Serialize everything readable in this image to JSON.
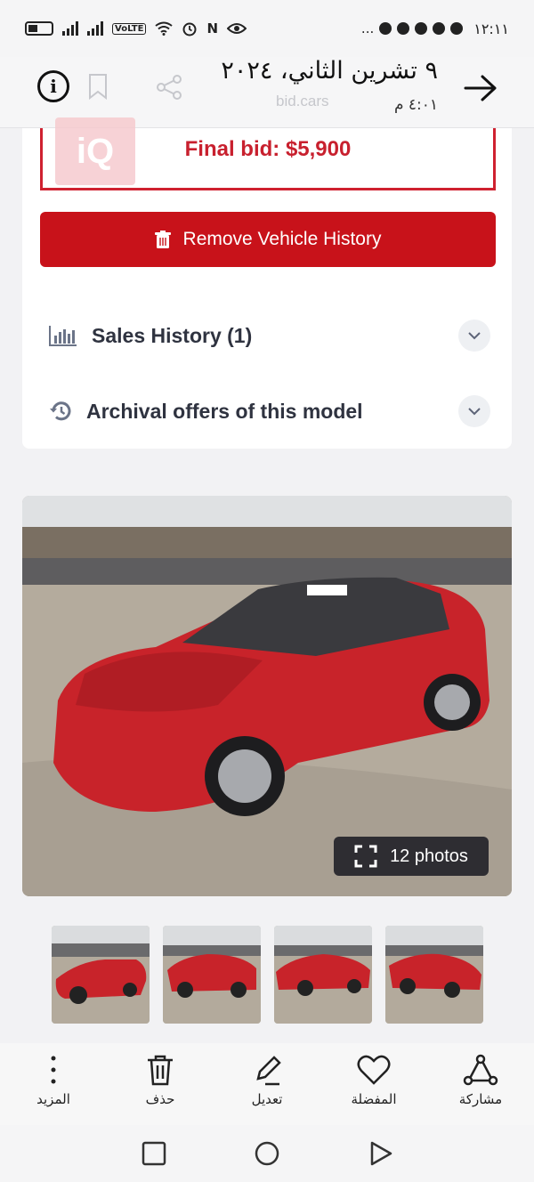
{
  "status_bar": {
    "time": "١٢:١١",
    "network": "VoLTE",
    "more": "..."
  },
  "gallery_header": {
    "date": "٩ تشرين الثاني، ٢٠٢٤",
    "time": "٤:٠١ م",
    "faded_site": "bid.cars"
  },
  "listing": {
    "final_bid": "Final bid: $5,900",
    "logo_text": "iQ",
    "remove_button": "Remove Vehicle History",
    "sales_history": "Sales History (1)",
    "archival_offers": "Archival offers of this model"
  },
  "photos": {
    "badge": "12 photos"
  },
  "actions": {
    "share": "مشاركة",
    "favorite": "المفضلة",
    "edit": "تعديل",
    "delete": "حذف",
    "more": "المزيد"
  },
  "colors": {
    "accent_red": "#c8121a",
    "car_red": "#c8232a"
  }
}
